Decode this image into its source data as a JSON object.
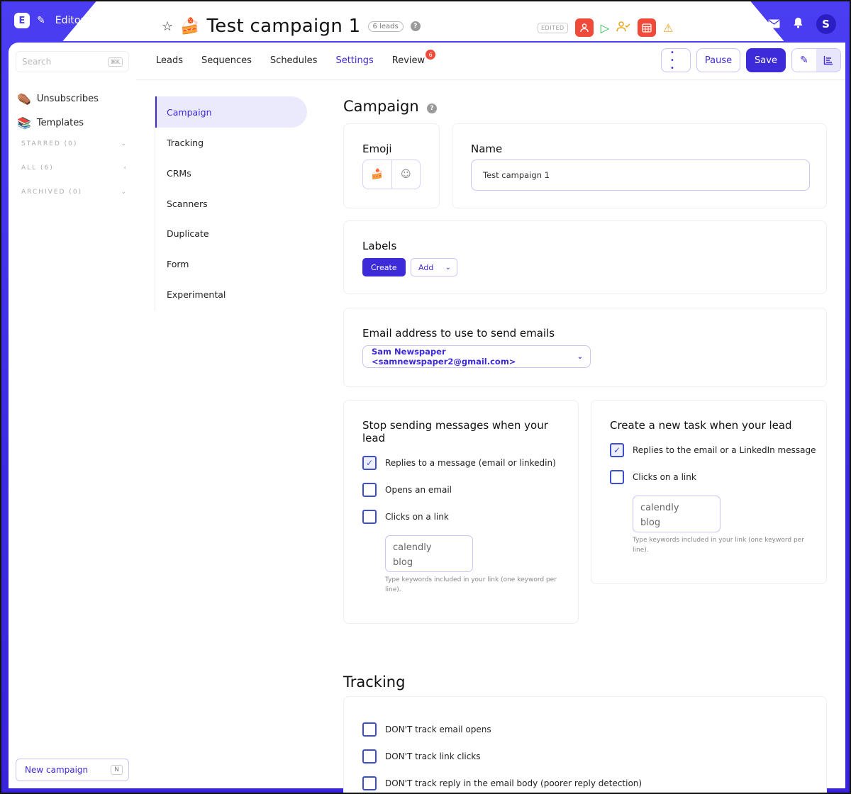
{
  "topbar": {
    "logo_letter": "E",
    "editor_label": "Editor",
    "campaign_emoji": "🍰",
    "campaign_title": "Test campaign 1",
    "leads_badge": "6 leads",
    "help": "?",
    "edited_badge": "EDITED"
  },
  "sidebar": {
    "search_placeholder": "Search",
    "search_shortcut": "⌘K",
    "items": [
      {
        "emoji": "⚰️",
        "label": "Unsubscribes"
      },
      {
        "emoji": "📚",
        "label": "Templates"
      }
    ],
    "sections": [
      {
        "label": "STARRED (0)",
        "chevron": "⌄"
      },
      {
        "label": "ALL (6)",
        "chevron": "‹"
      },
      {
        "label": "ARCHIVED (0)",
        "chevron": "⌄"
      }
    ],
    "new_campaign": "New campaign",
    "new_campaign_shortcut": "N"
  },
  "tabs": [
    {
      "label": "Leads"
    },
    {
      "label": "Sequences"
    },
    {
      "label": "Schedules"
    },
    {
      "label": "Settings",
      "active": true
    },
    {
      "label": "Review",
      "badge": "6"
    }
  ],
  "actions": {
    "more": "• • •",
    "pause": "Pause",
    "save": "Save"
  },
  "subnav": [
    "Campaign",
    "Tracking",
    "CRMs",
    "Scanners",
    "Duplicate",
    "Form",
    "Experimental"
  ],
  "campaign": {
    "title": "Campaign",
    "emoji_label": "Emoji",
    "emoji_value": "🍰",
    "name_label": "Name",
    "name_value": "Test campaign 1",
    "labels_label": "Labels",
    "create_btn": "Create",
    "add_btn": "Add",
    "email_label": "Email address to use to send emails",
    "email_value": "Sam Newspaper <samnewspaper2@gmail.com>",
    "stop_title": "Stop sending messages when your lead",
    "stop_options": [
      {
        "label": "Replies to a message (email or linkedin)",
        "checked": true
      },
      {
        "label": "Opens an email",
        "checked": false
      },
      {
        "label": "Clicks on a link",
        "checked": false
      }
    ],
    "stop_keywords": [
      "calendly",
      "blog"
    ],
    "keywords_hint": "Type keywords included in your link (one keyword per line).",
    "task_title": "Create a new task when your lead",
    "task_options": [
      {
        "label": "Replies to the email or a LinkedIn message",
        "checked": true
      },
      {
        "label": "Clicks on a link",
        "checked": false
      }
    ],
    "task_keywords": [
      "calendly",
      "blog"
    ]
  },
  "tracking": {
    "title": "Tracking",
    "options": [
      {
        "label": "DON'T track email opens",
        "checked": false
      },
      {
        "label": "DON'T track link clicks",
        "checked": false
      },
      {
        "label": "DON'T track reply in the email body (poorer reply detection)",
        "checked": false
      }
    ]
  }
}
